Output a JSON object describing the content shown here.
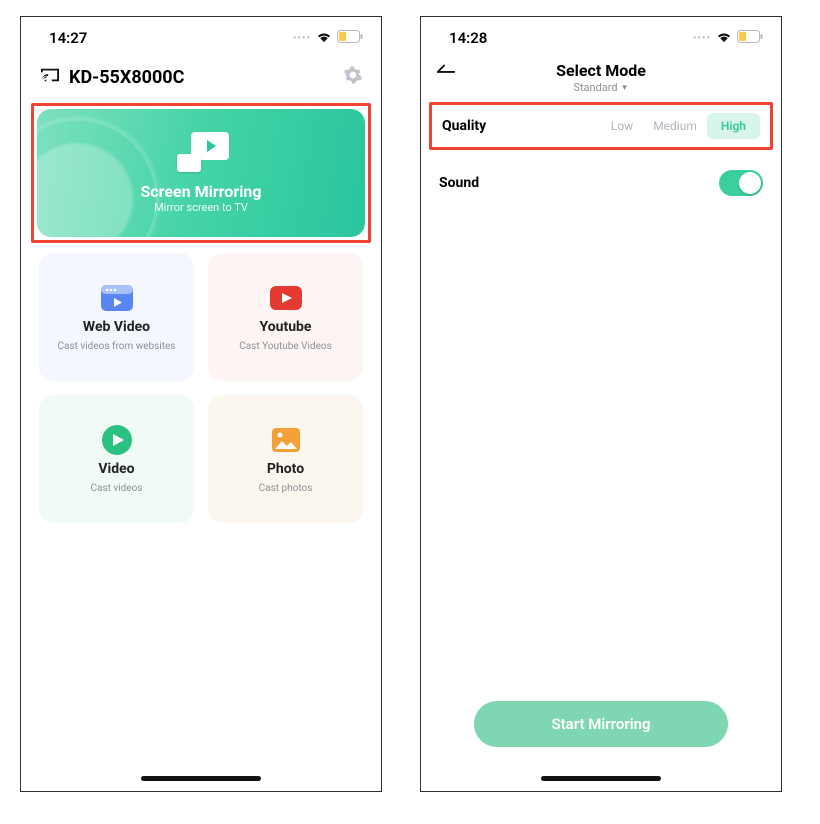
{
  "left": {
    "time": "14:27",
    "device_name": "KD-55X8000C",
    "hero": {
      "title": "Screen Mirroring",
      "sub": "Mirror screen to TV"
    },
    "tiles": {
      "web": {
        "title": "Web Video",
        "sub": "Cast videos from websites"
      },
      "yt": {
        "title": "Youtube",
        "sub": "Cast Youtube Videos"
      },
      "video": {
        "title": "Video",
        "sub": "Cast videos"
      },
      "photo": {
        "title": "Photo",
        "sub": "Cast photos"
      }
    }
  },
  "right": {
    "time": "14:28",
    "nav": {
      "title": "Select Mode",
      "sub": "Standard"
    },
    "quality": {
      "label": "Quality",
      "options": {
        "low": "Low",
        "medium": "Medium",
        "high": "High"
      },
      "selected": "high"
    },
    "sound": {
      "label": "Sound",
      "on": true
    },
    "cta": "Start Mirroring"
  }
}
